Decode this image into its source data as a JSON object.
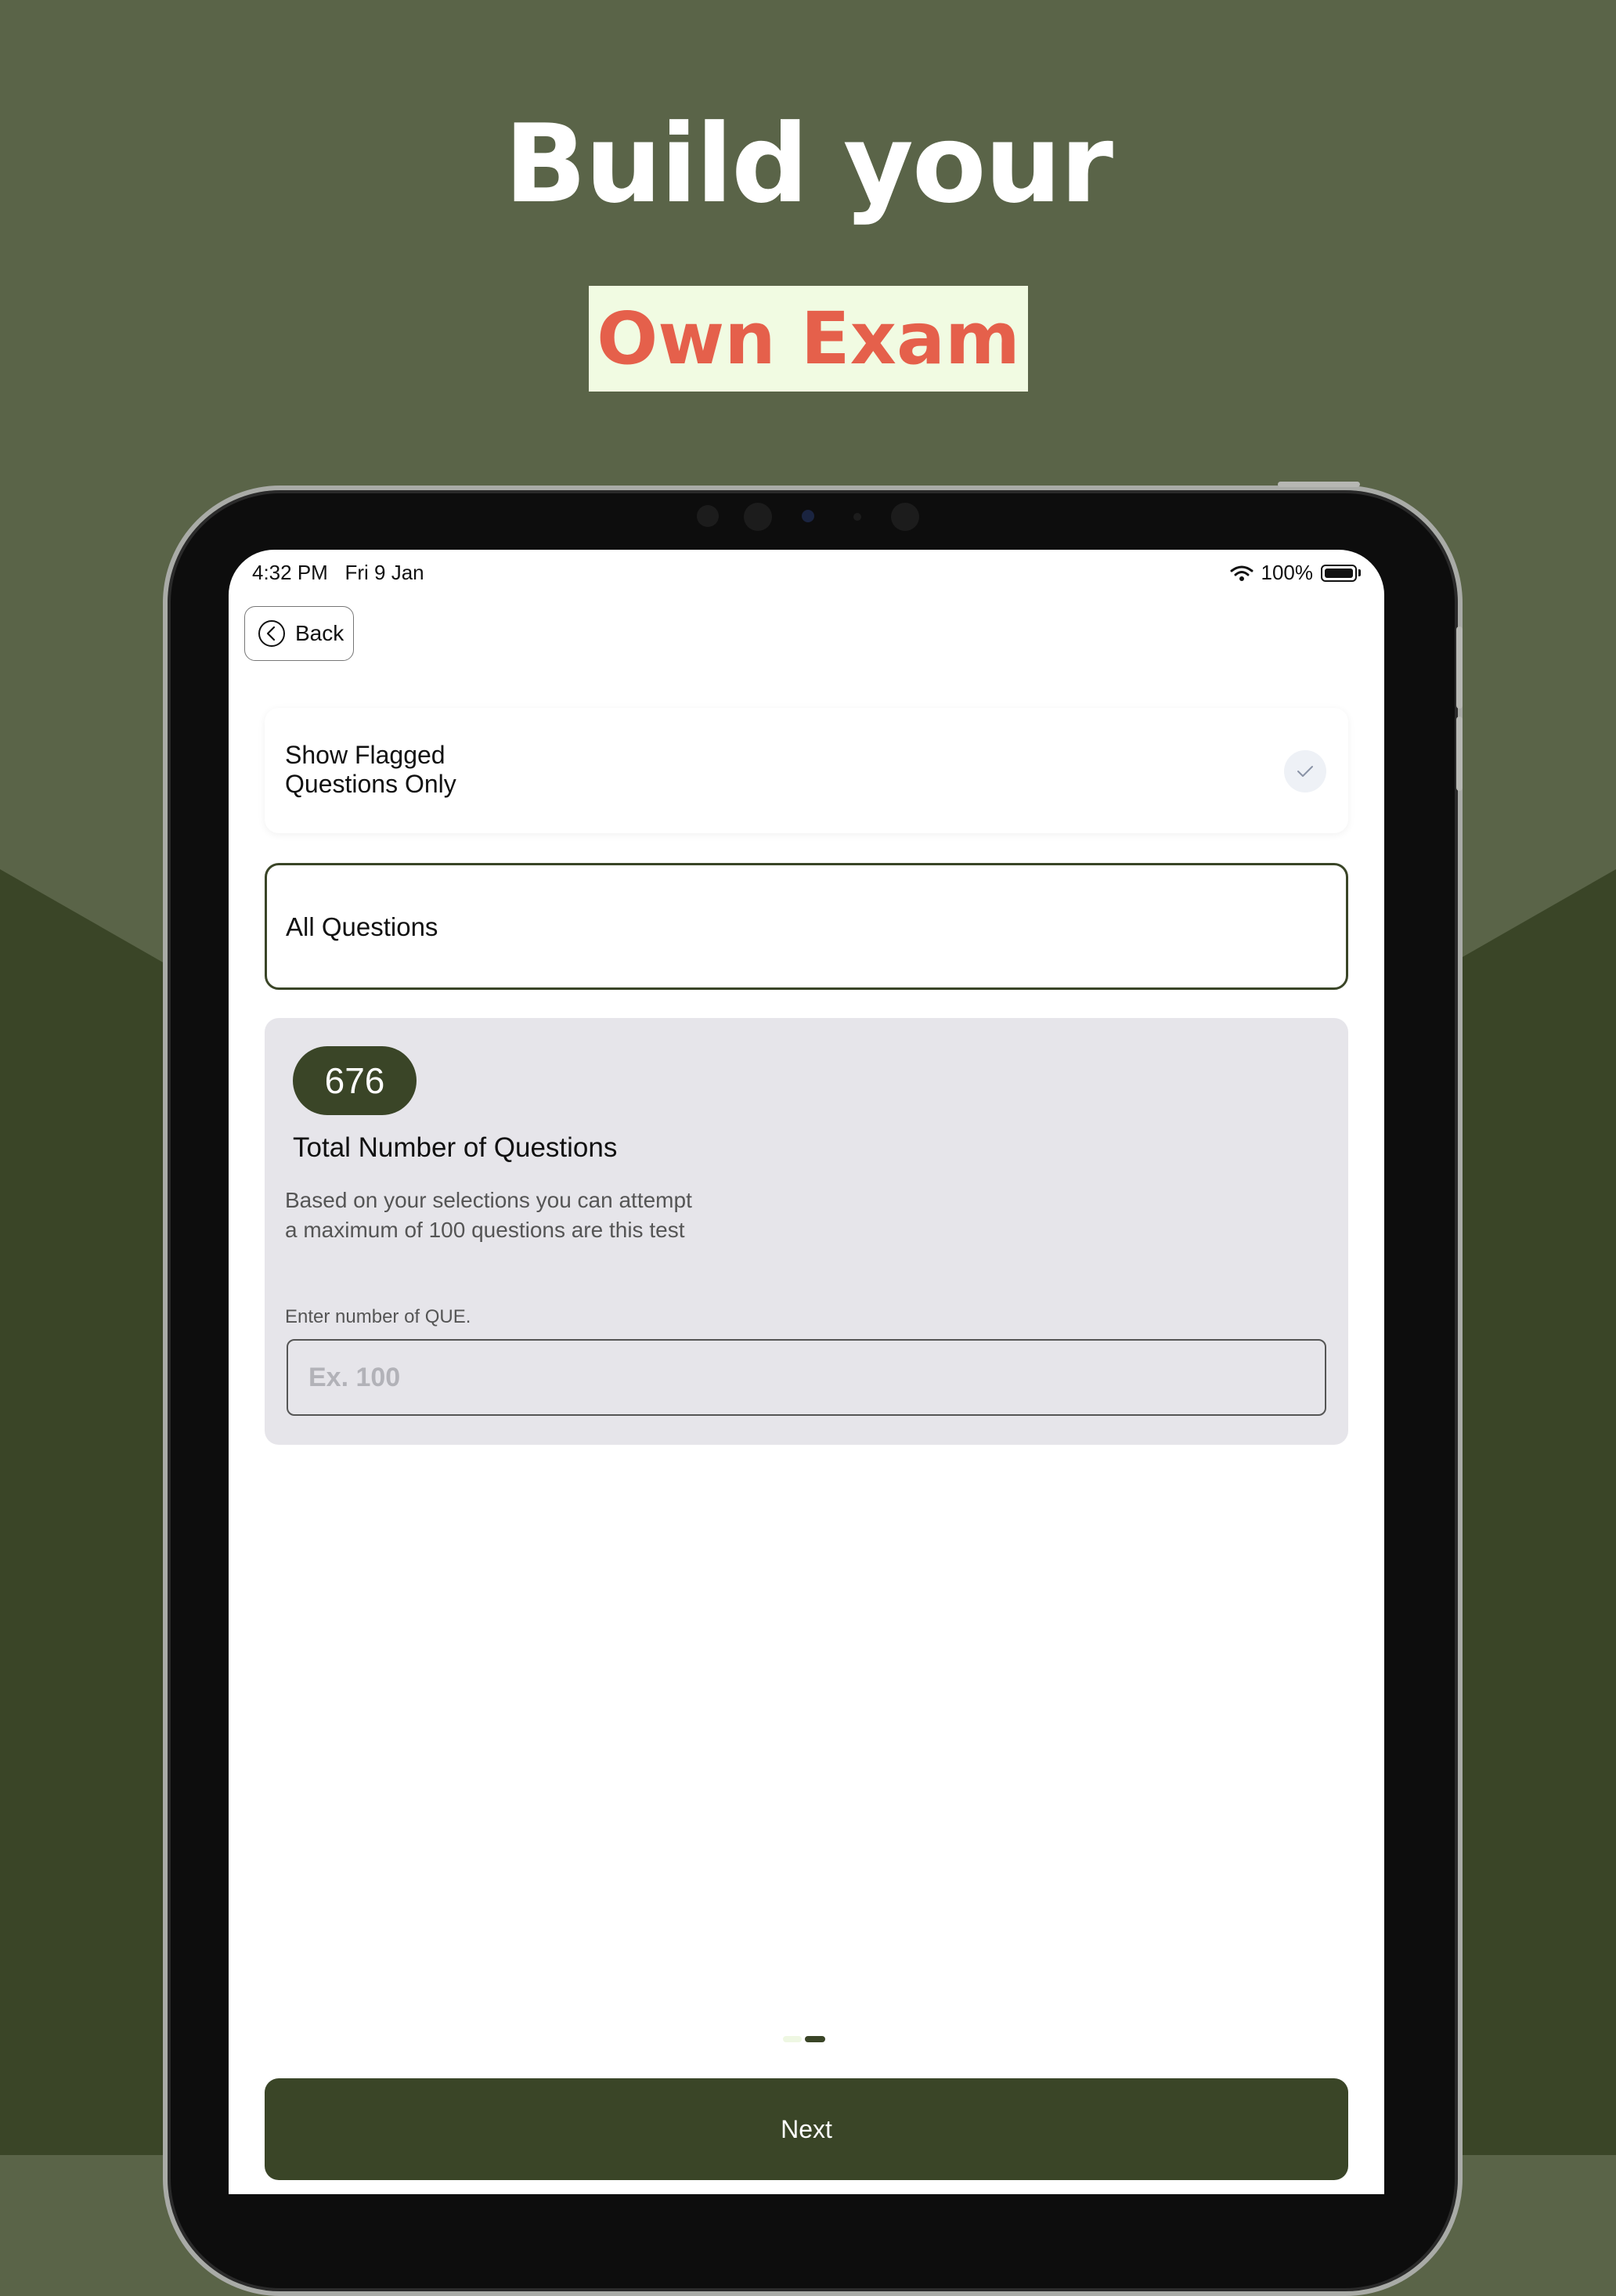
{
  "hero": {
    "headline": "Build your",
    "badge": "Own Exam"
  },
  "status_bar": {
    "time": "4:32 PM",
    "date": "Fri 9 Jan",
    "battery": "100%"
  },
  "nav": {
    "back_label": "Back"
  },
  "filters": {
    "flagged_label": "Show Flagged Questions Only",
    "flagged_checked": true,
    "all_questions_label": "All Questions"
  },
  "summary": {
    "total": "676",
    "title": "Total Number of Questions",
    "description": "Based on your selections you can attempt a maximum of 100 questions are this test",
    "input_hint": "Enter number of QUE.",
    "input_placeholder": "Ex. 100",
    "input_value": ""
  },
  "pager": {
    "pages": 2,
    "current": 2
  },
  "actions": {
    "next_label": "Next"
  },
  "colors": {
    "background_upper": "#5a6448",
    "background_lower": "#3a4527",
    "accent": "#3a4527",
    "badge_bg": "#f1fbe2",
    "badge_text": "#e5604b"
  },
  "icons": {
    "back": "chevron-left-circle-icon",
    "check": "check-icon",
    "wifi": "wifi-icon",
    "battery": "battery-icon"
  }
}
